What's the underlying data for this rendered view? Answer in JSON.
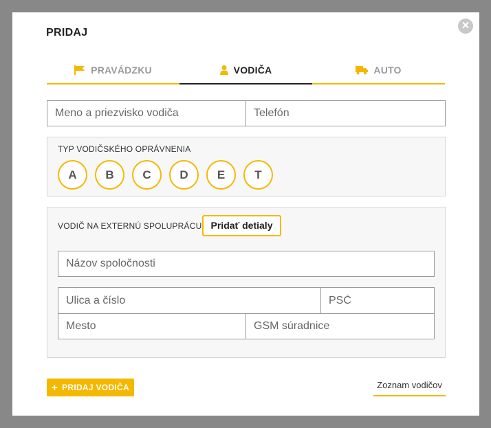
{
  "dialog": {
    "title": "PRIDAJ",
    "close_icon": "close-icon",
    "tabs": [
      {
        "label": "PRAVÁDZKU",
        "icon": "flag-icon",
        "active": false
      },
      {
        "label": "VODIČA",
        "icon": "person-icon",
        "active": true
      },
      {
        "label": "AUTO",
        "icon": "truck-icon",
        "active": false
      }
    ],
    "driver": {
      "name_placeholder": "Meno a priezvisko vodiča",
      "phone_placeholder": "Telefón"
    },
    "license": {
      "label": "TYP VODIČSKÉHO OPRÁVNENIA",
      "categories": [
        "A",
        "B",
        "C",
        "D",
        "E",
        "T"
      ]
    },
    "external": {
      "label": "VODIČ NA EXTERNÚ SPOLUPRÁCU",
      "details_button": "Pridať detialy",
      "company_placeholder": "Názov spoločnosti",
      "street_placeholder": "Ulica a číslo",
      "zip_placeholder": "PSČ",
      "city_placeholder": "Mesto",
      "gps_placeholder": "GSM súradnice"
    },
    "footer": {
      "add_button": "PRIDAJ VODIČA",
      "list_link": "Zoznam vodičov"
    },
    "accent_color": "#f5b800"
  }
}
